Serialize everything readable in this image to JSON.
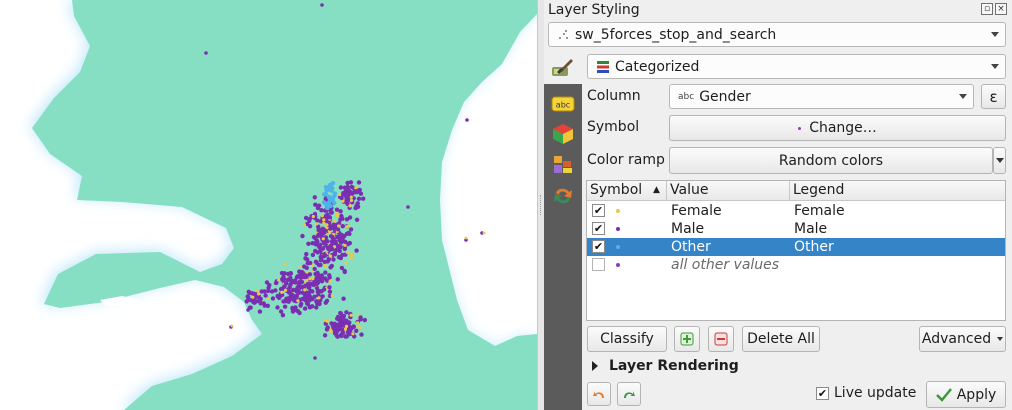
{
  "map": {
    "colors": {
      "land": "#86dfc2",
      "water": "#ffffff",
      "glow": "#bfe7fb",
      "female": "#e8c94a",
      "male": "#7a2fb2",
      "other": "#4fb3ea"
    }
  },
  "panel": {
    "title": "Layer Styling",
    "layer_name": "sw_5forces_stop_and_search",
    "renderer": "Categorized",
    "column_label": "Column",
    "column_type": "abc",
    "column_value": "Gender",
    "expression_icon": "ε",
    "symbol_label": "Symbol",
    "symbol_button": "Change…",
    "color_ramp_label": "Color ramp",
    "color_ramp_value": "Random colors",
    "table": {
      "headers": [
        "Symbol",
        "Value",
        "Legend"
      ],
      "rows": [
        {
          "checked": true,
          "color": "#e8c94a",
          "value": "Female",
          "legend": "Female",
          "selected": false,
          "italic": false
        },
        {
          "checked": true,
          "color": "#7a2fb2",
          "value": "Male",
          "legend": "Male",
          "selected": false,
          "italic": false
        },
        {
          "checked": true,
          "color": "#4fb3ea",
          "value": "Other",
          "legend": "Other",
          "selected": true,
          "italic": false
        },
        {
          "checked": false,
          "color": "#8e3cc2",
          "value": "all other values",
          "legend": "",
          "selected": false,
          "italic": true
        }
      ]
    },
    "classify_button": "Classify",
    "add_icon": "plus-icon",
    "remove_icon": "minus-icon",
    "delete_all_button": "Delete All",
    "advanced_button": "Advanced",
    "layer_rendering_label": "Layer Rendering",
    "live_update_label": "Live update",
    "live_update_checked": true,
    "apply_button": "Apply"
  }
}
